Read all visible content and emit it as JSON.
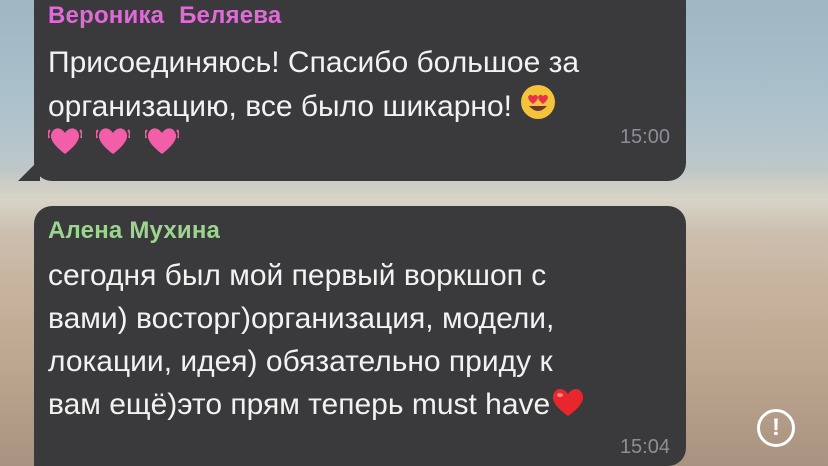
{
  "messages": [
    {
      "sender": "Вероника  Беляева",
      "text_line1": "Присоединяюсь! Спасибо большое за",
      "text_line2": "организацию, все было шикарно!",
      "emoji_end": "heart-eyes-emoji",
      "emoji_row": [
        "pink-heart-emoji",
        "pink-heart-emoji",
        "pink-heart-emoji"
      ],
      "time": "15:00",
      "sender_color": "#e06ad9"
    },
    {
      "sender": "Алена Мухина",
      "lines": [
        "сегодня был мой первый воркшоп с",
        "вами) восторг)организация, модели,",
        "локации, идея) обязательно приду к",
        "вам ещё)это прям теперь must have"
      ],
      "emoji_end": "red-heart-emoji",
      "time": "15:04",
      "sender_color": "#9bd58f"
    }
  ],
  "alert_icon": "exclamation-circle-icon",
  "alert_symbol": "!",
  "colors": {
    "bubble": "#3a3a3c",
    "text": "#f2f2f2",
    "time": "#8e8e93"
  }
}
